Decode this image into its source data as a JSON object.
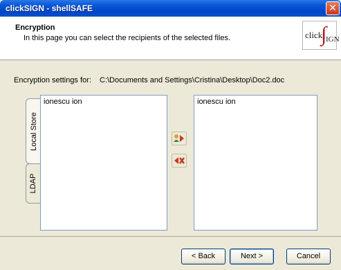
{
  "window": {
    "title": "clickSIGN - shellSAFE"
  },
  "header": {
    "title": "Encryption",
    "subtitle": "In this page you can select the recipients of the selected files.",
    "logo": {
      "prefix": "click",
      "mark": "∫",
      "suffix": "IGN"
    }
  },
  "settings": {
    "label": "Encryption settings for:",
    "path": "C:\\Documents and Settings\\Cristina\\Desktop\\Doc2.doc"
  },
  "tabs": [
    {
      "label": "Local Store",
      "selected": true
    },
    {
      "label": "LDAP",
      "selected": false
    }
  ],
  "left_list": {
    "items": [
      "ionescu ion"
    ]
  },
  "right_list": {
    "items": [
      "ionescu ion"
    ]
  },
  "actions": {
    "add_icon": "add-recipient-icon",
    "remove_icon": "remove-recipient-icon"
  },
  "buttons": {
    "back": "< Back",
    "next": "Next >",
    "cancel": "Cancel"
  },
  "colors": {
    "title_bar": "#0a58d8",
    "accent_red": "#c8381c",
    "face": "#ece9d8"
  }
}
